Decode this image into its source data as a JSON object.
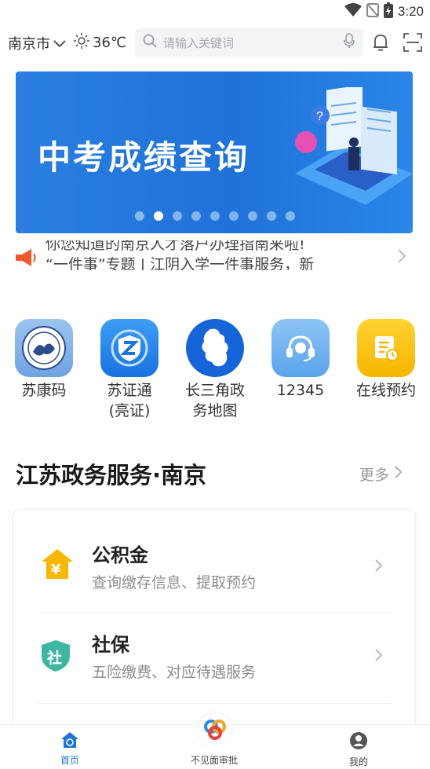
{
  "status_bar": {
    "time": "3:20",
    "icons": [
      "wifi-icon",
      "no-sim-icon",
      "battery-charging-icon"
    ]
  },
  "header": {
    "city": "南京市",
    "weather": "36℃",
    "weather_icon": "sun-icon",
    "search_placeholder": "请输入关键词",
    "icons": [
      "search-icon",
      "mic-icon",
      "bell-icon",
      "scan-icon"
    ]
  },
  "banner": {
    "title": "中考成绩查询",
    "slide_count": 9,
    "active_slide": 2,
    "color": "#1f72d8"
  },
  "notice": {
    "line1": "你您知道的南京人才落户办理指南来啦!",
    "line2": "“一件事”专题 | 江阴入学一件事服务，新"
  },
  "quick_services": [
    {
      "label": "苏康码",
      "icon": "sukangma-emblem-icon"
    },
    {
      "label": "苏证通(亮证)",
      "icon": "shield-z-icon"
    },
    {
      "label": "长三角政务地图",
      "icon": "map-icon"
    },
    {
      "label": "12345",
      "icon": "headset-icon"
    },
    {
      "label": "在线预约",
      "icon": "calendar-clock-icon"
    }
  ],
  "quick_labels": {
    "q1": "苏康码",
    "q2_line1": "苏证通",
    "q2_line2": "(亮证)",
    "q3_line1": "长三角政",
    "q3_line2": "务地图",
    "q4": "12345",
    "q5": "在线预约"
  },
  "section": {
    "title": "江苏政务服务·南京",
    "more": "更多",
    "items": [
      {
        "title": "公积金",
        "subtitle": "查询缴存信息、提取预约",
        "icon": "house-yuan-icon",
        "color": "#f6b800"
      },
      {
        "title": "社保",
        "subtitle": "五险缴费、对应待遇服务",
        "icon": "shield-she-icon",
        "color": "#3fb6a2"
      }
    ]
  },
  "tabbar": {
    "home": "首页",
    "center": "不见面审批",
    "me": "我的",
    "accent": "#1f72d8"
  }
}
